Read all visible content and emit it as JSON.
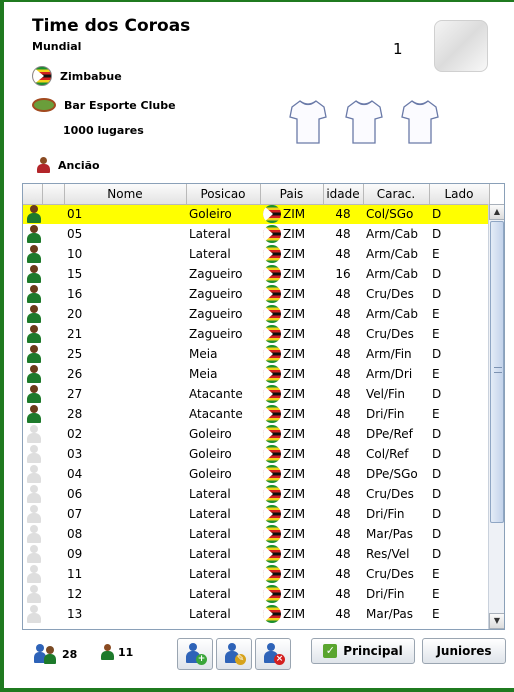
{
  "team": {
    "name": "Time dos Coroas",
    "competition": "Mundial",
    "number": "1",
    "country": "Zimbabue",
    "stadium": "Bar Esporte Clube",
    "capacity": "1000 lugares",
    "coach": "Ancião"
  },
  "table": {
    "columns": [
      "",
      "",
      "Nome",
      "Posicao",
      "Pais",
      "idade",
      "Carac.",
      "Lado"
    ],
    "rows": [
      {
        "icon": "player-green",
        "num": "01",
        "pos": "Goleiro",
        "pais": "ZIM",
        "idade": "48",
        "carac": "Col/SGo",
        "lado": "D",
        "selected": true
      },
      {
        "icon": "player-green",
        "num": "05",
        "pos": "Lateral",
        "pais": "ZIM",
        "idade": "48",
        "carac": "Arm/Cab",
        "lado": "D"
      },
      {
        "icon": "player-green",
        "num": "10",
        "pos": "Lateral",
        "pais": "ZIM",
        "idade": "48",
        "carac": "Arm/Cab",
        "lado": "E"
      },
      {
        "icon": "player-green",
        "num": "15",
        "pos": "Zagueiro",
        "pais": "ZIM",
        "idade": "16",
        "carac": "Arm/Cab",
        "lado": "D"
      },
      {
        "icon": "player-green",
        "num": "16",
        "pos": "Zagueiro",
        "pais": "ZIM",
        "idade": "48",
        "carac": "Cru/Des",
        "lado": "D"
      },
      {
        "icon": "player-green",
        "num": "20",
        "pos": "Zagueiro",
        "pais": "ZIM",
        "idade": "48",
        "carac": "Arm/Cab",
        "lado": "E"
      },
      {
        "icon": "player-green",
        "num": "21",
        "pos": "Zagueiro",
        "pais": "ZIM",
        "idade": "48",
        "carac": "Cru/Des",
        "lado": "E"
      },
      {
        "icon": "player-green",
        "num": "25",
        "pos": "Meia",
        "pais": "ZIM",
        "idade": "48",
        "carac": "Arm/Fin",
        "lado": "D"
      },
      {
        "icon": "player-green",
        "num": "26",
        "pos": "Meia",
        "pais": "ZIM",
        "idade": "48",
        "carac": "Arm/Dri",
        "lado": "E"
      },
      {
        "icon": "player-green",
        "num": "27",
        "pos": "Atacante",
        "pais": "ZIM",
        "idade": "48",
        "carac": "Vel/Fin",
        "lado": "D"
      },
      {
        "icon": "player-green",
        "num": "28",
        "pos": "Atacante",
        "pais": "ZIM",
        "idade": "48",
        "carac": "Dri/Fin",
        "lado": "E"
      },
      {
        "icon": "player-grey",
        "num": "02",
        "pos": "Goleiro",
        "pais": "ZIM",
        "idade": "48",
        "carac": "DPe/Ref",
        "lado": "D"
      },
      {
        "icon": "player-grey",
        "num": "03",
        "pos": "Goleiro",
        "pais": "ZIM",
        "idade": "48",
        "carac": "Col/Ref",
        "lado": "D"
      },
      {
        "icon": "player-grey",
        "num": "04",
        "pos": "Goleiro",
        "pais": "ZIM",
        "idade": "48",
        "carac": "DPe/SGo",
        "lado": "D"
      },
      {
        "icon": "player-grey",
        "num": "06",
        "pos": "Lateral",
        "pais": "ZIM",
        "idade": "48",
        "carac": "Cru/Des",
        "lado": "D"
      },
      {
        "icon": "player-grey",
        "num": "07",
        "pos": "Lateral",
        "pais": "ZIM",
        "idade": "48",
        "carac": "Dri/Fin",
        "lado": "D"
      },
      {
        "icon": "player-grey",
        "num": "08",
        "pos": "Lateral",
        "pais": "ZIM",
        "idade": "48",
        "carac": "Mar/Pas",
        "lado": "D"
      },
      {
        "icon": "player-grey",
        "num": "09",
        "pos": "Lateral",
        "pais": "ZIM",
        "idade": "48",
        "carac": "Res/Vel",
        "lado": "D"
      },
      {
        "icon": "player-grey",
        "num": "11",
        "pos": "Lateral",
        "pais": "ZIM",
        "idade": "48",
        "carac": "Cru/Des",
        "lado": "E"
      },
      {
        "icon": "player-grey",
        "num": "12",
        "pos": "Lateral",
        "pais": "ZIM",
        "idade": "48",
        "carac": "Dri/Fin",
        "lado": "E"
      },
      {
        "icon": "player-grey",
        "num": "13",
        "pos": "Lateral",
        "pais": "ZIM",
        "idade": "48",
        "carac": "Mar/Pas",
        "lado": "E"
      }
    ]
  },
  "footer": {
    "total_players": "28",
    "main_players": "11",
    "btn_principal": "Principal",
    "btn_juniores": "Juniores"
  },
  "colors": {
    "frame": "#1f7a1f",
    "selected_row": "#ffff00"
  }
}
